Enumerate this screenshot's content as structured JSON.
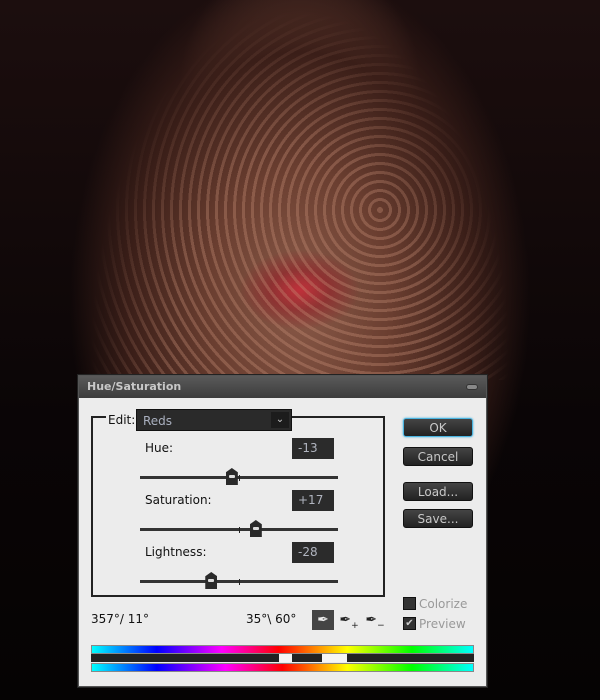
{
  "dialog": {
    "title": "Hue/Saturation",
    "edit_label": "Edit:",
    "edit_value": "Reds",
    "sliders": [
      {
        "label": "Hue:",
        "value": "-13",
        "level": -13,
        "min": -180,
        "max": 180
      },
      {
        "label": "Saturation:",
        "value": "+17",
        "level": 17,
        "min": -100,
        "max": 100
      },
      {
        "label": "Lightness:",
        "value": "-28",
        "level": -28,
        "min": -100,
        "max": 100
      }
    ],
    "buttons": {
      "ok": "OK",
      "cancel": "Cancel",
      "load": "Load...",
      "save": "Save..."
    },
    "colorize": {
      "label": "Colorize",
      "checked": false
    },
    "preview": {
      "label": "Preview",
      "checked": true,
      "mark": "✔"
    },
    "range_left": "357°/ 11°",
    "range_right": "35°\\ 60°",
    "icons": {
      "eyedropper": "eyedropper-icon",
      "add": "eyedropper-plus-icon",
      "sub": "eyedropper-minus-icon"
    }
  }
}
